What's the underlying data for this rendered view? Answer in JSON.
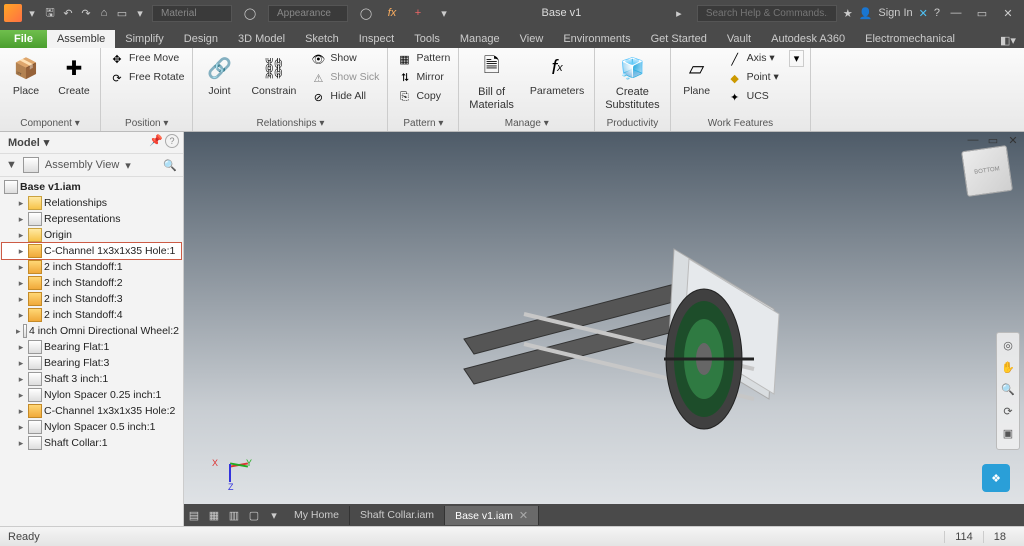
{
  "title_bar": {
    "material_placeholder": "Material",
    "appearance_placeholder": "Appearance",
    "document_title": "Base v1",
    "search_placeholder": "Search Help & Commands...",
    "sign_in": "Sign In"
  },
  "menu": {
    "file": "File",
    "tabs": [
      "Assemble",
      "Simplify",
      "Design",
      "3D Model",
      "Sketch",
      "Inspect",
      "Tools",
      "Manage",
      "View",
      "Environments",
      "Get Started",
      "Vault",
      "Autodesk A360",
      "Electromechanical"
    ],
    "active_index": 0
  },
  "ribbon": {
    "component": {
      "title": "Component ▾",
      "place": "Place",
      "create": "Create"
    },
    "position": {
      "title": "Position ▾",
      "free_move": "Free Move",
      "free_rotate": "Free Rotate"
    },
    "relationships": {
      "title": "Relationships ▾",
      "joint": "Joint",
      "constrain": "Constrain",
      "show": "Show",
      "show_sick": "Show Sick",
      "hide_all": "Hide All"
    },
    "pattern": {
      "title": "Pattern ▾",
      "pattern": "Pattern",
      "mirror": "Mirror",
      "copy": "Copy"
    },
    "manage": {
      "title": "Manage ▾",
      "bom": "Bill of",
      "bom2": "Materials",
      "parameters": "Parameters"
    },
    "productivity": {
      "title": "Productivity",
      "create_sub": "Create",
      "create_sub2": "Substitutes"
    },
    "work_features": {
      "title": "Work Features",
      "plane": "Plane",
      "axis": "Axis ▾",
      "point": "Point ▾",
      "ucs": "UCS"
    }
  },
  "model_panel": {
    "title": "Model",
    "assembly_view": "Assembly View",
    "root": "Base v1.iam",
    "nodes": [
      {
        "label": "Relationships",
        "type": "folder"
      },
      {
        "label": "Representations",
        "type": "rep"
      },
      {
        "label": "Origin",
        "type": "folder"
      },
      {
        "label": "C-Channel 1x3x1x35 Hole:1",
        "type": "part",
        "selected": true
      },
      {
        "label": "2 inch Standoff:1",
        "type": "part"
      },
      {
        "label": "2 inch Standoff:2",
        "type": "part"
      },
      {
        "label": "2 inch Standoff:3",
        "type": "part"
      },
      {
        "label": "2 inch Standoff:4",
        "type": "part"
      },
      {
        "label": "4 inch Omni Directional Wheel:2",
        "type": "asm"
      },
      {
        "label": "Bearing Flat:1",
        "type": "asm"
      },
      {
        "label": "Bearing Flat:3",
        "type": "asm"
      },
      {
        "label": "Shaft 3 inch:1",
        "type": "asm"
      },
      {
        "label": "Nylon Spacer 0.25 inch:1",
        "type": "asm"
      },
      {
        "label": "C-Channel 1x3x1x35 Hole:2",
        "type": "part"
      },
      {
        "label": "Nylon Spacer 0.5 inch:1",
        "type": "asm"
      },
      {
        "label": "Shaft Collar:1",
        "type": "asm"
      }
    ]
  },
  "viewcube_face": "BOTTOM",
  "triad": {
    "x": "X",
    "y": "Y",
    "z": "Z"
  },
  "doc_tabs": {
    "tabs": [
      {
        "label": "My Home",
        "closable": false
      },
      {
        "label": "Shaft Collar.iam",
        "closable": false
      },
      {
        "label": "Base v1.iam",
        "closable": true,
        "active": true
      }
    ]
  },
  "status": {
    "ready": "Ready",
    "num1": "114",
    "num2": "18"
  }
}
